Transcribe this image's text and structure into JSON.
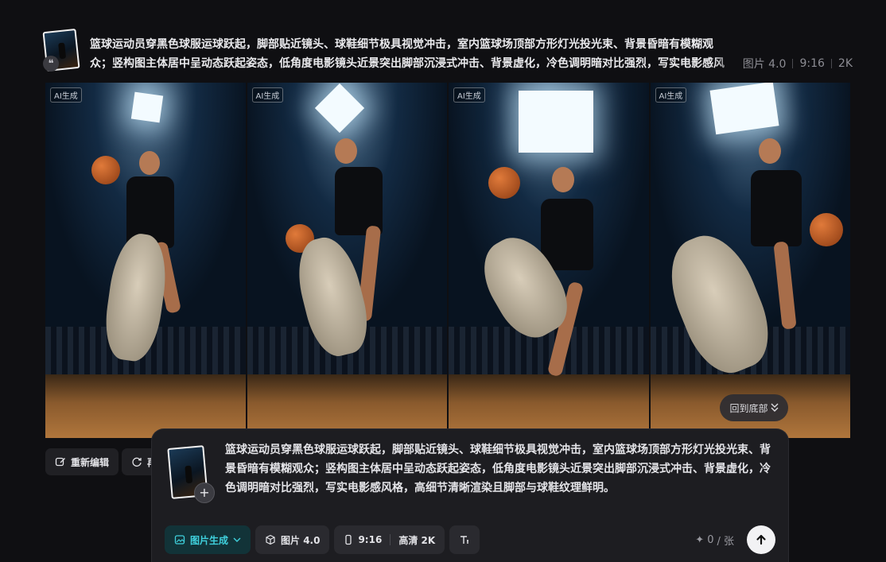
{
  "header_prompt": {
    "text": "篮球运动员穿黑色球服运球跃起，脚部贴近镜头、球鞋细节极具视觉冲击，室内篮球场顶部方形灯光投光束、背景昏暗有模糊观众；竖构图主体居中呈动态跃起姿态，低角度电影镜头近景突出脚部沉浸式冲击、背景虚化，冷色调明暗对比强烈，写实电影感风格，高细节清晰渲染且脚部与",
    "meta": [
      "图片 4.0",
      "9:16",
      "2K"
    ],
    "quote_icon": "quote-icon"
  },
  "images": [
    {
      "badge": "AI生成"
    },
    {
      "badge": "AI生成"
    },
    {
      "badge": "AI生成"
    },
    {
      "badge": "AI生成"
    }
  ],
  "back_to_bottom": {
    "label": "回到底部",
    "icon": "double-chevron-down-icon"
  },
  "actions": {
    "reedit": {
      "label": "重新编辑",
      "icon": "edit-icon"
    },
    "regenerate": {
      "label": "再",
      "icon": "refresh-icon"
    }
  },
  "composer": {
    "text": "篮球运动员穿黑色球服运球跃起，脚部贴近镜头、球鞋细节极具视觉冲击，室内篮球场顶部方形灯光投光束、背景昏暗有模糊观众；竖构图主体居中呈动态跃起姿态，低角度电影镜头近景突出脚部沉浸式冲击、背景虚化，冷色调明暗对比强烈，写实电影感风格，高细节清晰渲染且脚部与球鞋纹理鲜明。",
    "add_icon": "plus-icon",
    "mode": {
      "label": "图片生成",
      "icon": "image-icon"
    },
    "model": {
      "label": "图片 4.0",
      "icon": "cube-icon"
    },
    "ratio": {
      "label": "9:16",
      "icon": "portrait-icon"
    },
    "quality": {
      "label": "高清 2K"
    },
    "text_tool": {
      "icon": "text-format-icon"
    },
    "credits": {
      "value": "0",
      "unit": "/ 张",
      "icon": "sparkle-icon"
    },
    "send": {
      "icon": "arrow-up-icon"
    }
  },
  "colors": {
    "accent": "#3fd0dc",
    "background": "#0f0f12",
    "panel": "#1d1d21"
  }
}
